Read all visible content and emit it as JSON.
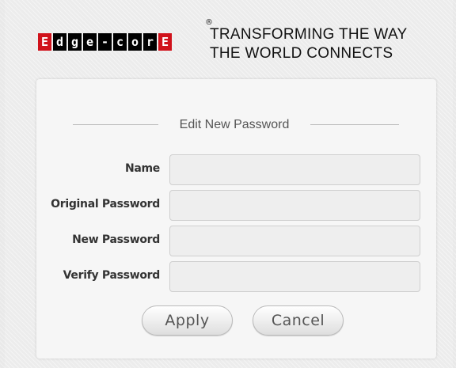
{
  "header": {
    "logo_letters": [
      "E",
      "d",
      "g",
      "e",
      "-",
      "c",
      "o",
      "r",
      "E"
    ],
    "logo_registered_mark": "®",
    "tagline_line1": "TRANSFORMING THE WAY",
    "tagline_line2": "THE WORLD CONNECTS"
  },
  "form": {
    "legend": "Edit New Password",
    "fields": [
      {
        "label": "Name",
        "value": ""
      },
      {
        "label": "Original Password",
        "value": ""
      },
      {
        "label": "New Password",
        "value": ""
      },
      {
        "label": "Verify Password",
        "value": ""
      }
    ],
    "buttons": {
      "apply_label": "Apply",
      "cancel_label": "Cancel"
    }
  },
  "colors": {
    "brand_red": "#d0121b",
    "brand_black": "#000000"
  }
}
